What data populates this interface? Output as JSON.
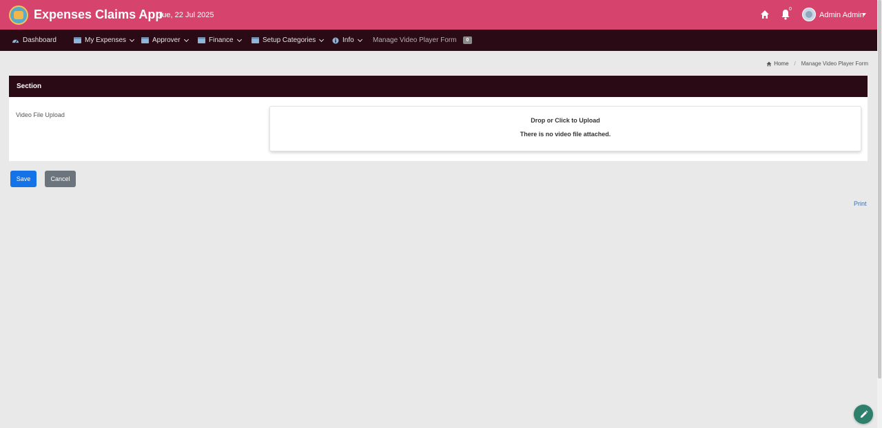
{
  "header": {
    "app_title": "Expenses Claims App",
    "date": "Tue, 22 Jul 2025",
    "notification_count": "0",
    "user_name": "Admin Admin"
  },
  "nav": {
    "dashboard": "Dashboard",
    "my_expenses": "My Expenses",
    "approver": "Approver",
    "finance": "Finance",
    "setup_categories": "Setup Categories",
    "info": "Info",
    "manage_video": "Manage Video Player Form",
    "manage_video_badge": "0"
  },
  "breadcrumb": {
    "home": "Home",
    "current": "Manage Video Player Form"
  },
  "section": {
    "title": "Section",
    "field_label": "Video File Upload",
    "dropzone_title": "Drop or Click to Upload",
    "dropzone_status": "There is no video file attached."
  },
  "actions": {
    "save": "Save",
    "cancel": "Cancel",
    "print": "Print"
  },
  "colors": {
    "header_bg": "#d6446e",
    "nav_bg": "#2a0a14",
    "save_btn": "#1473e6",
    "cancel_btn": "#6c757d",
    "fab": "#2e7f6c"
  }
}
